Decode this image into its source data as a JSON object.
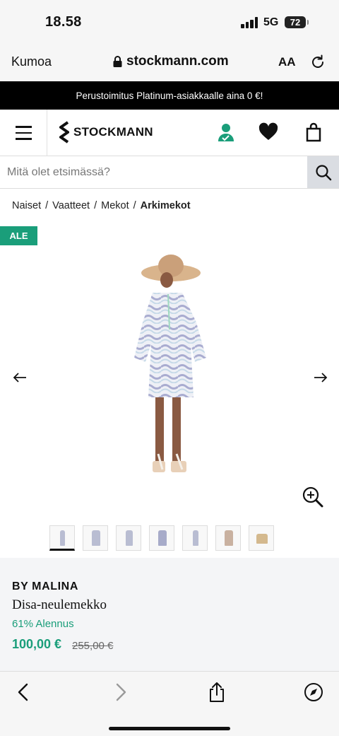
{
  "status": {
    "time": "18.58",
    "network": "5G",
    "battery": "72"
  },
  "browser": {
    "undo_label": "Kumoa",
    "url": "stockmann.com",
    "text_size": "AA"
  },
  "promo": {
    "text": "Perustoimitus Platinum-asiakkaalle aina 0 €!"
  },
  "header": {
    "logo": "STOCKMANN"
  },
  "search": {
    "placeholder": "Mitä olet etsimässä?"
  },
  "breadcrumb": [
    {
      "label": "Naiset"
    },
    {
      "label": "Vaatteet"
    },
    {
      "label": "Mekot"
    },
    {
      "label": "Arkimekot"
    }
  ],
  "product": {
    "badge": "ALE",
    "brand": "BY MALINA",
    "name": "Disa-neulemekko",
    "discount": "61% Alennus",
    "price": "100,00 €",
    "original_price": "255,00 €",
    "thumbnail_count": 7,
    "active_thumbnail": 1
  },
  "colors": {
    "accent": "#1a9e7a",
    "promo_bg": "#000000"
  }
}
